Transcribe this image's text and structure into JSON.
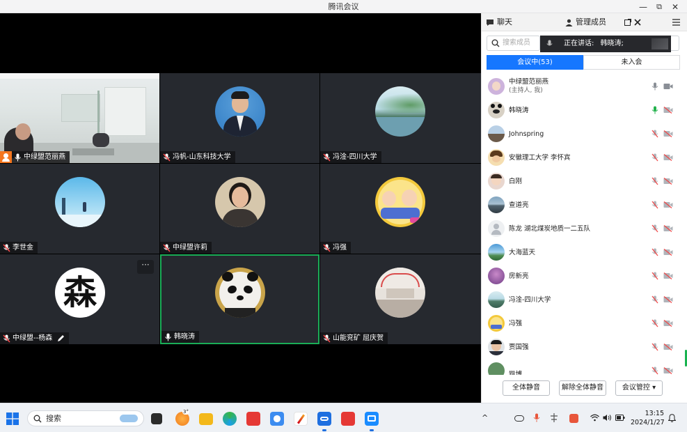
{
  "window": {
    "title": "腾讯会议",
    "minimize": "—",
    "restore": "⧉",
    "close": "✕"
  },
  "tiles": [
    {
      "name": "中绿盟范丽燕",
      "host": true
    },
    {
      "name": "冯帆-山东科技大学"
    },
    {
      "name": "冯淦-四川大学"
    },
    {
      "name": "李世金"
    },
    {
      "name": "中绿盟许莉"
    },
    {
      "name": "冯强"
    },
    {
      "name": "中绿盟--杨森",
      "avatar_text": "森",
      "more": "···"
    },
    {
      "name": "韩晓涛",
      "active": true
    },
    {
      "name": "山能兖矿 屈庆贺"
    }
  ],
  "panel": {
    "tab_chat": "聊天",
    "tab_members": "管理成员",
    "search_placeholder": "搜索成员",
    "speaking_label": "正在讲话:",
    "speaking_name": "韩晓涛;",
    "in_meeting": "会议中(53)",
    "not_joined": "未入会",
    "members": [
      {
        "name": "中绿盟范丽燕",
        "sub": "(主持人, 我)"
      },
      {
        "name": "韩晓涛"
      },
      {
        "name": "Johnspring"
      },
      {
        "name": "安徽理工大学 李怀宾"
      },
      {
        "name": "白刚"
      },
      {
        "name": "查道亮"
      },
      {
        "name": "陈龙 湖北煤炭地质一二五队"
      },
      {
        "name": "大海蓝天"
      },
      {
        "name": "房新亮"
      },
      {
        "name": "冯淦-四川大学"
      },
      {
        "name": "冯强"
      },
      {
        "name": "贾国强"
      },
      {
        "name": "锴博"
      }
    ],
    "mute_all": "全体静音",
    "unmute_all": "解除全体静音",
    "meeting_control": "会议管控 ▾"
  },
  "taskbar": {
    "search": "搜索",
    "weather": "3°",
    "time": "13:15",
    "date": "2024/1/27",
    "chevron": "^"
  }
}
